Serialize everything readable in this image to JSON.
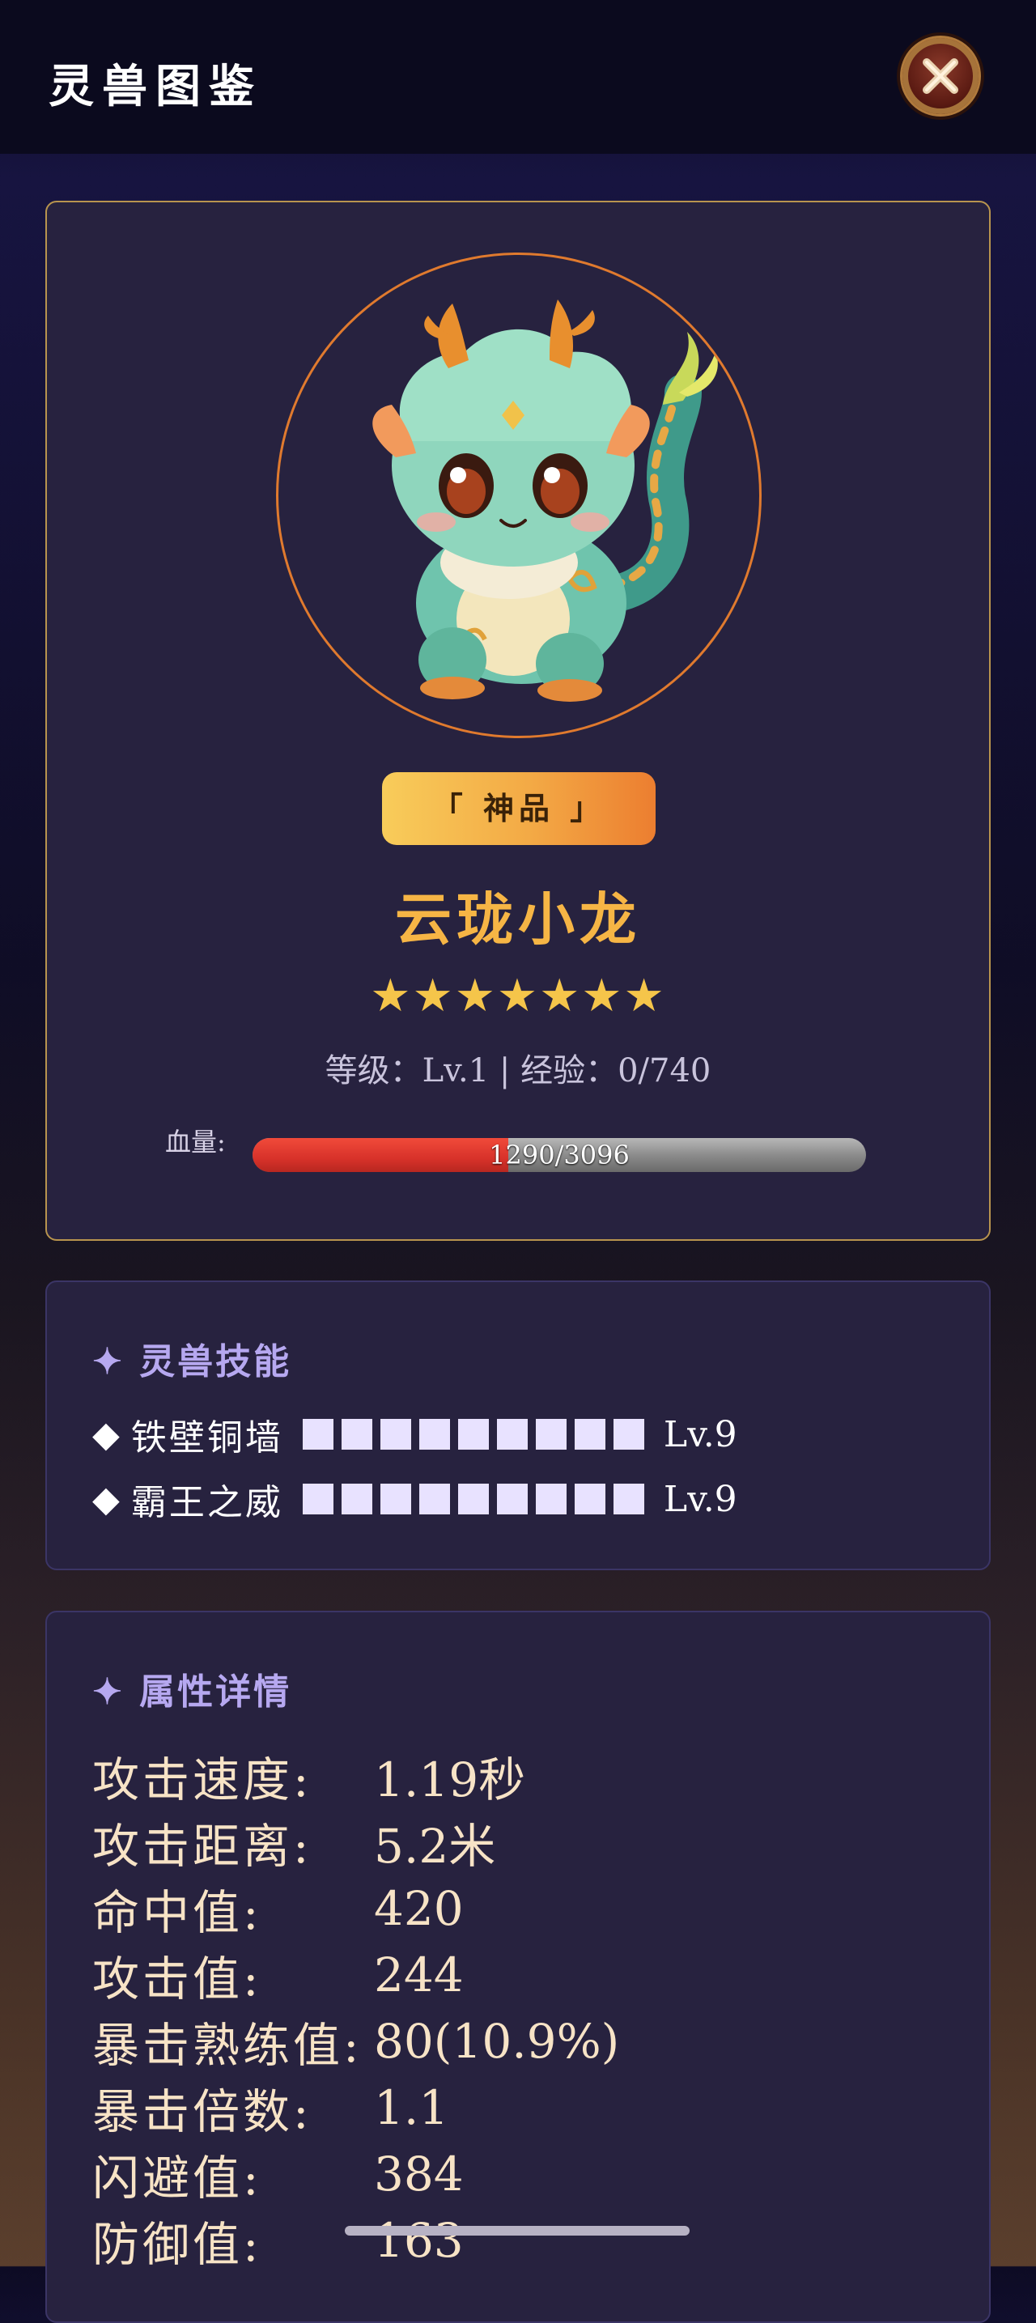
{
  "header": {
    "title": "灵兽图鉴",
    "close_icon": "close-x-icon"
  },
  "profile": {
    "portrait_alt": "green-baby-dragon-portrait",
    "rank": "「 神品 」",
    "name": "云珑小龙",
    "stars": "★★★★★★★",
    "star_count": 7,
    "level_line": "等级：Lv.1 | 经验：0/740",
    "hp": {
      "label": "血量:",
      "current": 1290,
      "max": 3096,
      "text": "1290/3096"
    }
  },
  "skills": {
    "title": "✦ 灵兽技能",
    "items": [
      {
        "bullet": "◆",
        "name": "铁壁铜墙",
        "blocks": 9,
        "level": "Lv.9"
      },
      {
        "bullet": "◆",
        "name": "霸王之威",
        "blocks": 9,
        "level": "Lv.9"
      }
    ]
  },
  "attributes": {
    "title": "✦ 属性详情",
    "rows": [
      {
        "key": "攻击速度:",
        "value": "1.19秒"
      },
      {
        "key": "攻击距离:",
        "value": "5.2米"
      },
      {
        "key": "命中值:",
        "value": "420"
      },
      {
        "key": "攻击值:",
        "value": "244"
      },
      {
        "key": "暴击熟练值:",
        "value": "80(10.9%)"
      },
      {
        "key": "暴击倍数:",
        "value": "1.1"
      },
      {
        "key": "闪避值:",
        "value": "384"
      },
      {
        "key": "防御值:",
        "value": "163"
      }
    ]
  },
  "colors": {
    "accent_gold": "#f6b545",
    "hp_red": "#d8322a",
    "section_purple": "#b6a8f0"
  }
}
